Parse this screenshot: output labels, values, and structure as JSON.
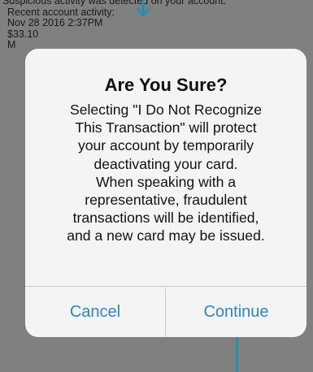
{
  "background": {
    "lines": [
      "Suspicious activity was detected on your account.",
      "Recent account activity:",
      "Nov 28 2016  2:37PM",
      "$33.10",
      "M"
    ]
  },
  "dialog": {
    "title": "Are You Sure?",
    "message_lines": [
      "Selecting \"I Do Not Recognize",
      "This Transaction\" will protect",
      "your account by temporarily",
      "deactivating your card.",
      "When speaking with a",
      "representative, fraudulent",
      "transactions will be identified,",
      "and a new card may be issued."
    ],
    "cancel_label": "Cancel",
    "continue_label": "Continue"
  },
  "colors": {
    "accent": "#2f86c8",
    "annotation": "#2a8dad",
    "overlay": "#808080"
  },
  "icons": {
    "pointer": "arrow-down-icon"
  }
}
